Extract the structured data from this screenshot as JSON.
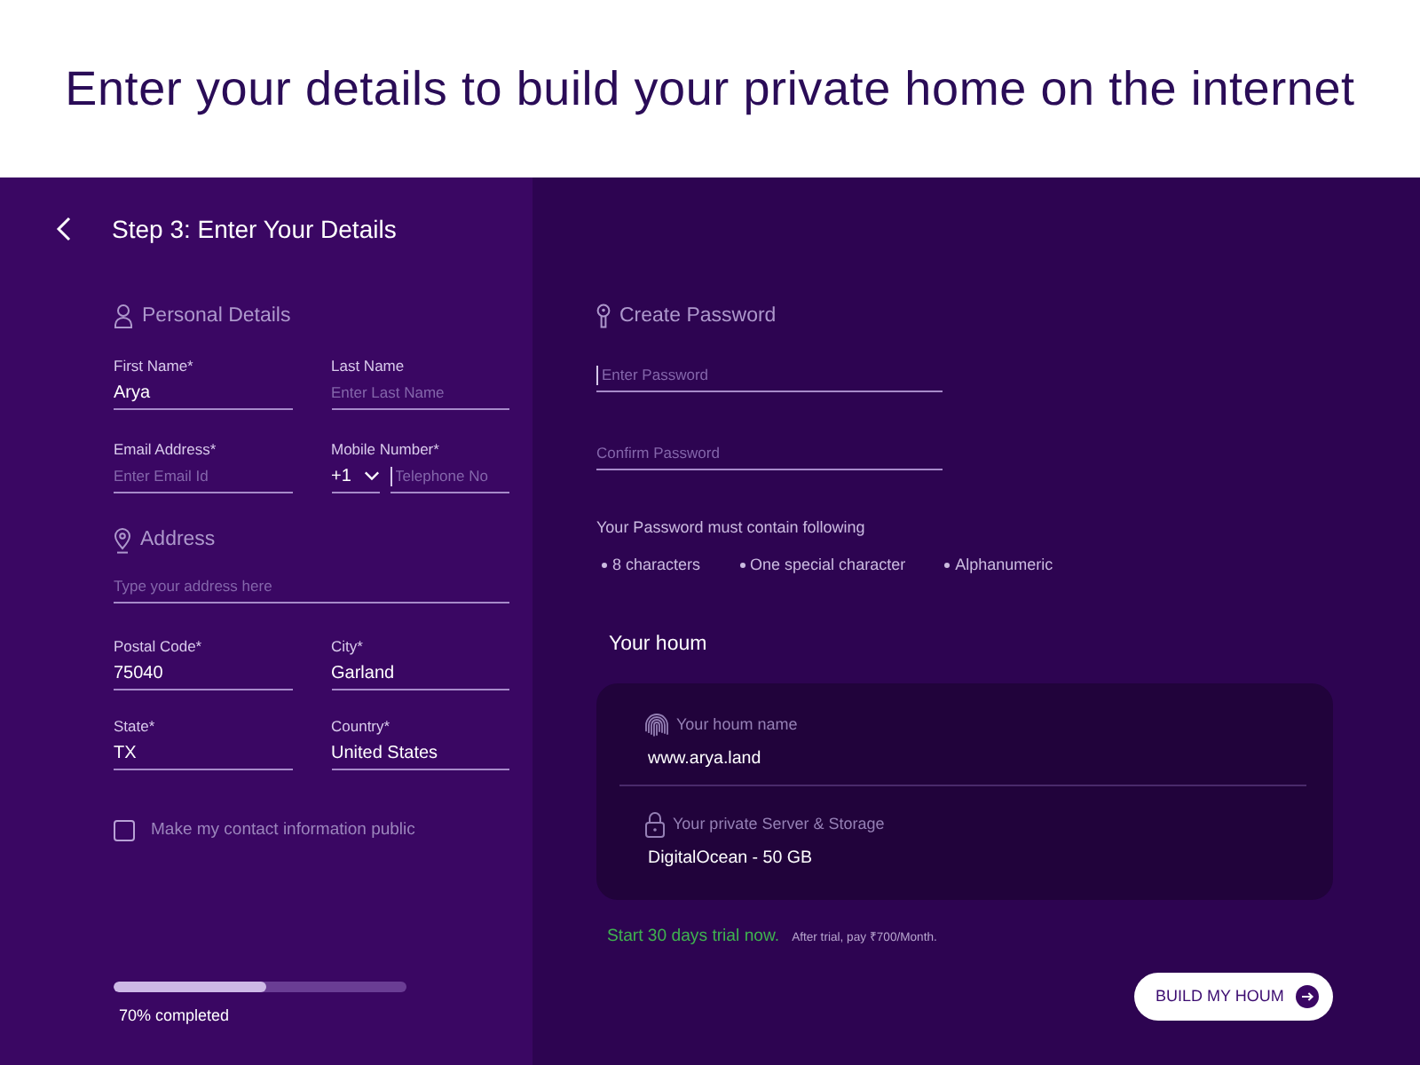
{
  "header": {
    "title": "Enter your details to build your private home on the internet"
  },
  "details": {
    "step_title": "Step 3: Enter Your Details",
    "personal": {
      "heading": "Personal Details",
      "rows": [
        [
          {
            "kind": "text",
            "label": "First Name*",
            "value": "Arya",
            "caret": false
          },
          {
            "kind": "text",
            "label": "Last Name",
            "placeholder": "Enter Last Name",
            "caret": false
          }
        ],
        [
          {
            "kind": "text",
            "label": "Email Address*",
            "placeholder": "Enter Email Id",
            "caret": false
          },
          {
            "kind": "phone",
            "label": "Mobile Number*",
            "country_code": "+1",
            "placeholder": "Telephone No",
            "caret": true
          }
        ]
      ]
    },
    "address": {
      "heading": "Address",
      "line": {
        "placeholder": "Type your address here",
        "caret": false
      },
      "rows": [
        [
          {
            "kind": "text",
            "label": "Postal Code*",
            "value": "75040",
            "caret": false
          },
          {
            "kind": "text",
            "label": "City*",
            "value": "Garland",
            "caret": false
          }
        ],
        [
          {
            "kind": "text",
            "label": "State*",
            "value": "TX",
            "caret": false
          },
          {
            "kind": "text",
            "label": "Country*",
            "value": "United States",
            "caret": false
          }
        ]
      ]
    },
    "public_contact": {
      "label": "Make my contact information public",
      "checked": false
    },
    "progress": {
      "level": 0.52,
      "label": "70% completed"
    }
  },
  "password": {
    "heading": "Create Password",
    "fields": [
      {
        "placeholder": "Enter Password",
        "caret": true
      },
      {
        "placeholder": "Confirm Password",
        "caret": false
      }
    ],
    "rules_title": "Your Password must contain following",
    "rules": [
      "8 characters",
      "One special character",
      "Alphanumeric"
    ]
  },
  "houm": {
    "title": "Your houm",
    "items": [
      {
        "kind": "name",
        "label": "Your houm name",
        "value": "www.arya.land"
      },
      {
        "kind": "server",
        "label": "Your private Server & Storage",
        "value": "DigitalOcean - 50 GB"
      }
    ]
  },
  "trial": {
    "offer": "Start 30 days trial now.",
    "note": "After trial, pay ₹700/Month."
  },
  "build_button": {
    "label": "BUILD MY HOUM"
  }
}
